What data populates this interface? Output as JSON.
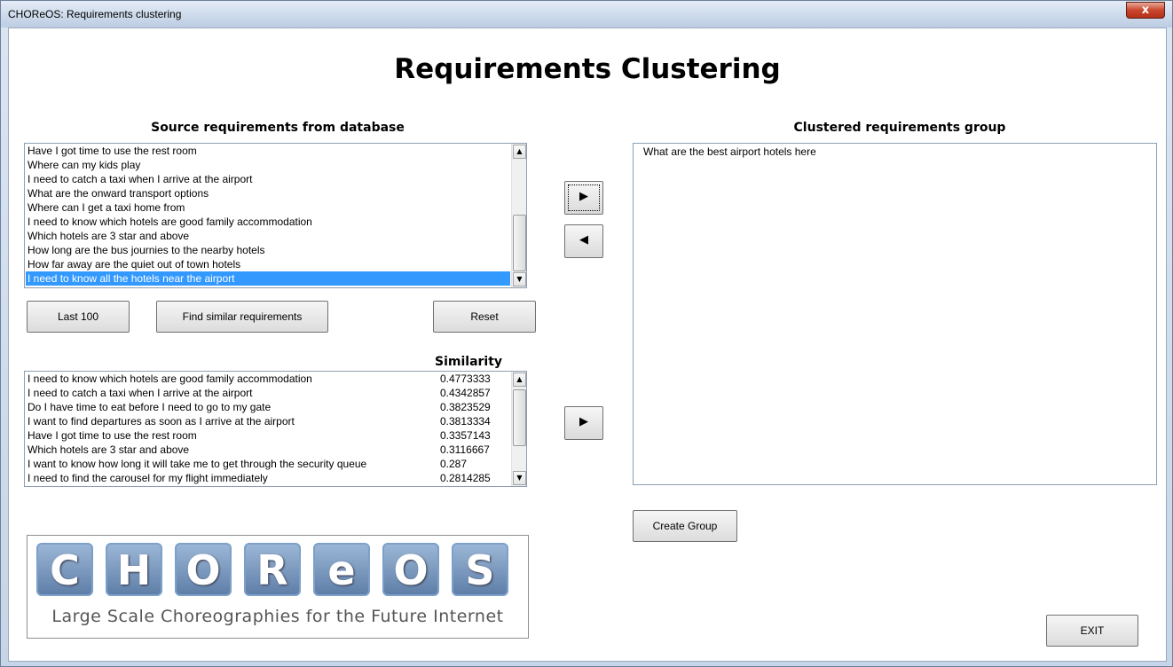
{
  "window": {
    "title": "CHOReOS: Requirements clustering",
    "close_glyph": "x"
  },
  "main": {
    "title": "Requirements Clustering"
  },
  "source": {
    "heading": "Source requirements from database",
    "items": [
      "Have I got time to use the rest room",
      "Where can my kids play",
      "I need to catch a taxi when I arrive at the airport",
      "What are the onward transport options",
      "Where can I get a taxi home from",
      "I need to know which hotels are good family accommodation",
      "Which hotels are 3 star and above",
      "How long are the bus journies to the nearby hotels",
      "How far away are the quiet out of town hotels",
      "I need to know all the hotels near the airport"
    ],
    "selected_index": 9
  },
  "buttons": {
    "last100": "Last 100",
    "find_similar": "Find similar requirements",
    "reset": "Reset",
    "create_group": "Create Group",
    "exit": "EXIT",
    "add_arrow": "▶",
    "remove_arrow": "◀",
    "add_similar_arrow": "▶",
    "scroll_up": "▲",
    "scroll_down": "▼"
  },
  "similar": {
    "heading": "Similarity",
    "rows": [
      {
        "text": "I need to know which hotels are good family accommodation",
        "value": "0.4773333"
      },
      {
        "text": "I need to catch a taxi when I arrive at the airport",
        "value": "0.4342857"
      },
      {
        "text": "Do I have time to eat before I need to go to my gate",
        "value": "0.3823529"
      },
      {
        "text": "I want to find departures as soon as I arrive at the airport",
        "value": "0.3813334"
      },
      {
        "text": "Have I got time to use the rest room",
        "value": "0.3357143"
      },
      {
        "text": "Which hotels are 3 star and above",
        "value": "0.3116667"
      },
      {
        "text": "I want to know how long it will take me to get through the security queue",
        "value": "0.287"
      },
      {
        "text": "I need to find the carousel for my flight immediately",
        "value": "0.2814285"
      }
    ]
  },
  "clustered": {
    "heading": "Clustered requirements group",
    "items": [
      "What are the best airport hotels here"
    ]
  },
  "logo": {
    "letters": [
      "C",
      "H",
      "O",
      "R",
      "e",
      "O",
      "S"
    ],
    "tagline": "Large Scale Choreographies for the Future Internet"
  }
}
